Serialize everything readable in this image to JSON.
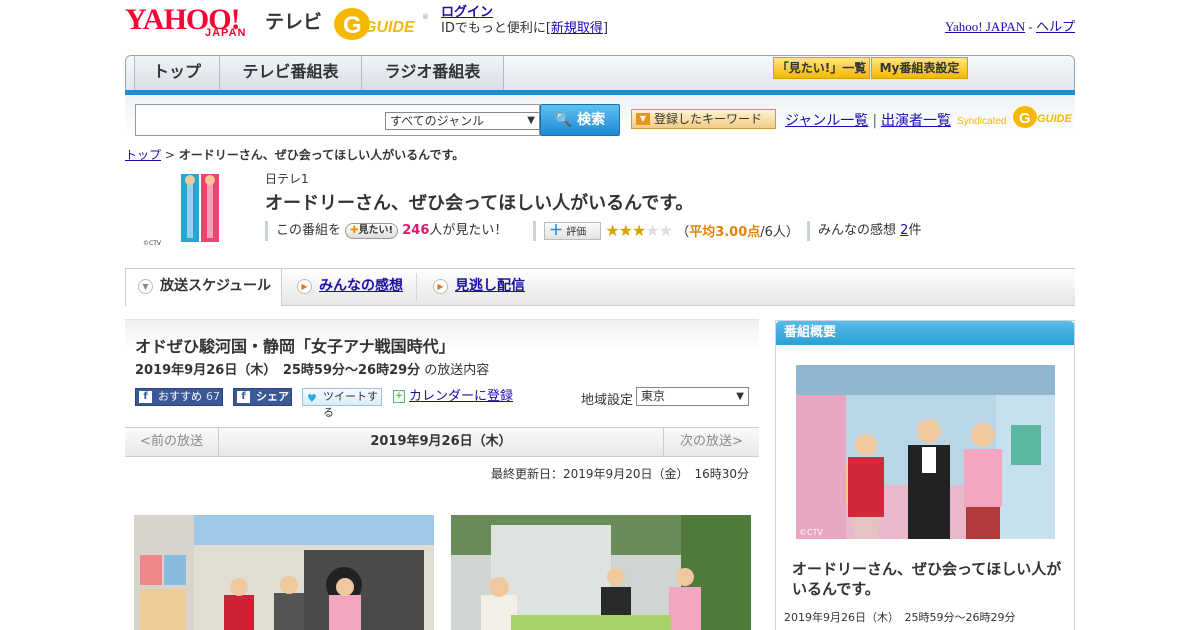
{
  "header": {
    "logo_text": "YAHOO!",
    "logo_sub": "JAPAN",
    "service": "テレビ",
    "gguide_text": "G GUIDE",
    "login": "ログイン",
    "login_note_prefix": "IDでもっと便利に[",
    "register": "新規取得",
    "login_note_suffix": "]",
    "yahoo_japan": "Yahoo! JAPAN",
    "sep": " - ",
    "help": "ヘルプ"
  },
  "nav": {
    "tabs": [
      "トップ",
      "テレビ番組表",
      "ラジオ番組表"
    ],
    "want_list": "「見たい!」一覧",
    "my_schedule": "My番組表設定"
  },
  "search": {
    "input_value": "",
    "genre": "すべてのジャンル",
    "button": "検索",
    "keyword_button": "登録したキーワード",
    "genre_list": "ジャンル一覧",
    "divider": "|",
    "performer_list": "出演者一覧",
    "syndicated": "Syndicated"
  },
  "breadcrumb": {
    "top": "トップ",
    "arrow": " > ",
    "current": "オードリーさん、ぜひ会ってほしい人がいるんです。"
  },
  "program": {
    "thumb_text": "オードリーさん、ぜひ会ってほしい人がいるんです。",
    "thumb_credit": "©CTV",
    "station": "日テレ1",
    "title": "オードリーさん、ぜひ会ってほしい人がいるんです。",
    "this_program": "この番組を",
    "mitai_button": "見たい!",
    "want_count": "246",
    "want_suffix": "人が見たい！",
    "rating_button": "評価",
    "avg_prefix": "（",
    "avg_label": "平均3.00点",
    "avg_people": "/6人）",
    "rating": 3,
    "rating_max": 5,
    "reviews_label": "みんなの感想",
    "reviews_count": "2",
    "reviews_suffix": "件"
  },
  "tabs": {
    "schedule": "放送スケジュール",
    "reviews": "みんなの感想",
    "streaming": "見逃し配信"
  },
  "episode": {
    "title": "オドぜひ駿河国・静岡「女子アナ戦国時代」",
    "date_time": "2019年9月26日（木）　25時59分～26時29分",
    "date_suffix": "の放送内容",
    "fb_recommend": "おすすめ",
    "fb_count": "67",
    "fb_share": "シェア",
    "tweet": "ツイートする",
    "calendar": "カレンダーに登録",
    "region_label": "地域設定",
    "region": "東京",
    "prev": "<前の放送",
    "current_date": "2019年9月26日（木）",
    "next": "次の放送>",
    "last_updated": "最終更新日：2019年9月20日（金）　16時30分"
  },
  "sidebar": {
    "heading": "番組概要",
    "photo_credit": "©CTV",
    "title": "オードリーさん、ぜひ会ってほしい人がいるんです。",
    "date_time": "2019年9月26日（木）　25時59分～26時29分"
  }
}
